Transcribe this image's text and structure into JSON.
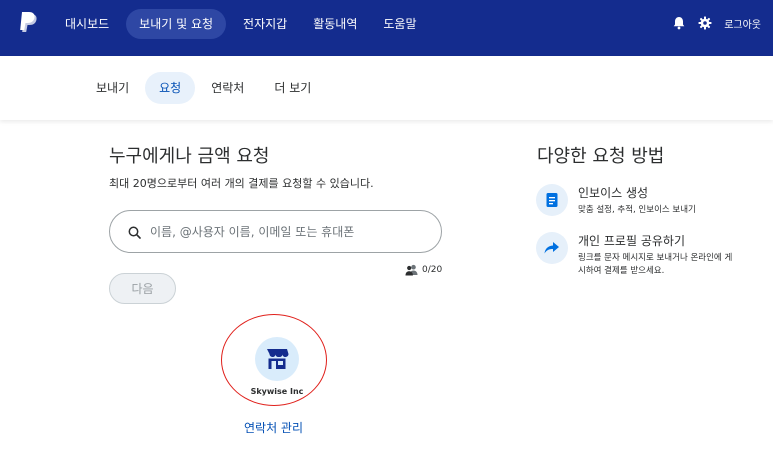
{
  "topnav": {
    "items": [
      {
        "label": "대시보드",
        "active": false
      },
      {
        "label": "보내기 및 요청",
        "active": true
      },
      {
        "label": "전자지갑",
        "active": false
      },
      {
        "label": "활동내역",
        "active": false
      },
      {
        "label": "도움말",
        "active": false
      }
    ],
    "logout_label": "로그아웃"
  },
  "subnav": {
    "items": [
      {
        "label": "보내기",
        "active": false
      },
      {
        "label": "요청",
        "active": true
      },
      {
        "label": "연락처",
        "active": false
      },
      {
        "label": "더 보기",
        "active": false
      }
    ]
  },
  "main": {
    "title": "누구에게나 금액 요청",
    "subtitle": "최대 20명으로부터 여러 개의 결제를 요청할 수 있습니다.",
    "search_placeholder": "이름, @사용자 이름, 이메일 또는 휴대폰",
    "search_value": "",
    "recipient_count": "0/20",
    "next_label": "다음",
    "contact": {
      "name": "Skywise Inc"
    },
    "manage_contacts_label": "연락처 관리"
  },
  "side": {
    "title": "다양한 요청 방법",
    "options": [
      {
        "label": "인보이스 생성",
        "desc": "맞춤 설정, 추적, 인보이스 보내기",
        "icon": "invoice-icon"
      },
      {
        "label": "개인 프로필 공유하기",
        "desc": "링크를 문자 메시지로 보내거나 온라인에 게시하여 결제를 받으세요.",
        "icon": "share-arrow-icon"
      }
    ]
  },
  "colors": {
    "header_bg": "#142c8e",
    "accent": "#0551b5",
    "annotation_red": "#e0201b"
  }
}
